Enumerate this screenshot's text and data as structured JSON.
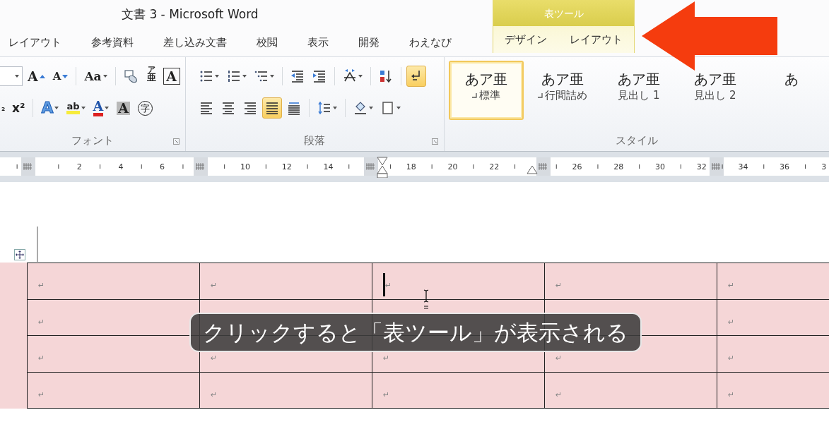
{
  "window": {
    "title": "文書 3 - Microsoft Word"
  },
  "tabs": [
    {
      "label": "レイアウト",
      "selected": false
    },
    {
      "label": "参考資料",
      "selected": false
    },
    {
      "label": "差し込み文書",
      "selected": false
    },
    {
      "label": "校閲",
      "selected": false
    },
    {
      "label": "表示",
      "selected": false
    },
    {
      "label": "開発",
      "selected": false
    },
    {
      "label": "わえなび",
      "selected": false
    }
  ],
  "contextual_tab_group": {
    "label": "表ツール",
    "tabs": [
      {
        "label": "デザイン",
        "selected": false
      },
      {
        "label": "レイアウト",
        "selected": false
      }
    ]
  },
  "ribbon": {
    "font_group": {
      "label": "フォント",
      "top_row": [
        {
          "buttons": [
            {
              "kind": "size_field",
              "dropdown": true,
              "selected": false
            },
            {
              "kind": "grow",
              "glyph": "A",
              "selected": false
            },
            {
              "kind": "shrink",
              "glyph": "A",
              "selected": false
            }
          ]
        },
        {
          "buttons": [
            {
              "kind": "case",
              "glyph": "Aa",
              "dropdown": true,
              "selected": false
            }
          ]
        },
        {
          "buttons": [
            {
              "kind": "phonetic",
              "selected": false
            },
            {
              "kind": "ruby",
              "glyph": "亜",
              "ruby": "ア",
              "selected": false
            },
            {
              "kind": "boxed",
              "glyph": "A",
              "selected": false
            }
          ]
        }
      ],
      "bottom_row": [
        {
          "buttons": [
            {
              "kind": "subscript",
              "glyph": "₂",
              "selected": false
            },
            {
              "kind": "superscript",
              "glyph": "x²",
              "selected": false
            }
          ]
        },
        {
          "buttons": [
            {
              "kind": "effects",
              "glyph": "A",
              "dropdown": true,
              "selected": false
            },
            {
              "kind": "highlight",
              "glyph": "ab",
              "dropdown": true,
              "selected": false
            },
            {
              "kind": "font_color",
              "glyph": "A",
              "dropdown": true,
              "selected": false
            },
            {
              "kind": "char_shading",
              "glyph": "A",
              "selected": false
            },
            {
              "kind": "enclosed",
              "glyph": "字",
              "selected": false
            }
          ]
        }
      ]
    },
    "paragraph_group": {
      "label": "段落",
      "top_row": [
        {
          "buttons": [
            {
              "kind": "bullets",
              "dropdown": true,
              "selected": false
            },
            {
              "kind": "numbering",
              "dropdown": true,
              "selected": false
            },
            {
              "kind": "multilevel",
              "dropdown": true,
              "selected": false
            }
          ]
        },
        {
          "buttons": [
            {
              "kind": "dec_indent",
              "selected": false
            },
            {
              "kind": "inc_indent",
              "selected": false
            }
          ]
        },
        {
          "buttons": [
            {
              "kind": "asian_layout",
              "dropdown": true,
              "selected": false
            }
          ]
        },
        {
          "buttons": [
            {
              "kind": "sort",
              "selected": false
            }
          ]
        },
        {
          "buttons": [
            {
              "kind": "show_marks",
              "selected": true
            }
          ]
        }
      ],
      "bottom_row": [
        {
          "buttons": [
            {
              "kind": "align_left",
              "selected": false
            },
            {
              "kind": "align_center",
              "selected": false
            },
            {
              "kind": "align_right",
              "selected": false
            },
            {
              "kind": "justify",
              "selected": true
            },
            {
              "kind": "distribute",
              "selected": false
            }
          ]
        },
        {
          "buttons": [
            {
              "kind": "line_spacing",
              "dropdown": true,
              "selected": false
            }
          ]
        },
        {
          "buttons": [
            {
              "kind": "para_shading",
              "dropdown": true,
              "selected": false
            },
            {
              "kind": "borders",
              "dropdown": true,
              "selected": false
            }
          ]
        }
      ]
    },
    "styles_group": {
      "label": "スタイル",
      "styles": [
        {
          "preview": "あア亜",
          "name": "標準",
          "para_mark": true,
          "selected": true
        },
        {
          "preview": "あア亜",
          "name": "行間詰め",
          "para_mark": true,
          "selected": false
        },
        {
          "preview": "あア亜",
          "name": "見出し 1",
          "selected": false
        },
        {
          "preview": "あア亜",
          "name": "見出し 2",
          "selected": false
        },
        {
          "preview": "あ",
          "selected": false
        }
      ]
    }
  },
  "ruler": {
    "labels": [
      "2",
      "4",
      "6",
      "10",
      "12",
      "14",
      "18",
      "20",
      "22",
      "26",
      "28",
      "30",
      "32",
      "34",
      "36",
      "3"
    ]
  },
  "table": {
    "rows": [
      [
        {
          "text": "↵",
          "caret": false
        },
        {
          "text": "↵",
          "caret": false
        },
        {
          "text": "↵",
          "caret": true
        },
        {
          "text": "↵",
          "caret": false
        },
        {
          "text": "↵",
          "caret": false
        }
      ],
      [
        {
          "text": "↵",
          "caret": false
        },
        {
          "caret": false
        },
        {
          "caret": false
        },
        {
          "caret": false
        },
        {
          "text": "↵",
          "caret": false
        }
      ],
      [
        {
          "text": "↵",
          "caret": false
        },
        {
          "text": "↵",
          "caret": false
        },
        {
          "text": "↵",
          "caret": false
        },
        {
          "text": "↵",
          "caret": false
        },
        {
          "text": "↵",
          "caret": false
        }
      ],
      [
        {
          "text": "↵",
          "caret": false
        },
        {
          "text": "↵",
          "caret": false
        },
        {
          "text": "↵",
          "caret": false
        },
        {
          "text": "↵",
          "caret": false
        },
        {
          "text": "↵",
          "caret": false
        }
      ]
    ]
  },
  "caption": {
    "text": "クリックすると「表ツール」が表示される"
  }
}
